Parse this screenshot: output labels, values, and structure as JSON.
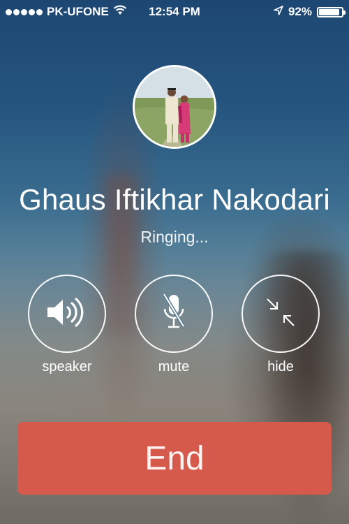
{
  "status_bar": {
    "carrier": "PK-UFONE",
    "time": "12:54 PM",
    "battery": "92%",
    "battery_level": 0.92,
    "signal_bars": 5,
    "icons": [
      "signal-dots-icon",
      "wifi-icon",
      "location-arrow-icon",
      "battery-icon"
    ]
  },
  "caller": {
    "name": "Ghaus Iftikhar Nakodari",
    "status": "Ringing..."
  },
  "controls": {
    "speaker_label": "speaker",
    "mute_label": "mute",
    "hide_label": "hide"
  },
  "end_button": {
    "label": "End",
    "color": "#d65a4c"
  }
}
